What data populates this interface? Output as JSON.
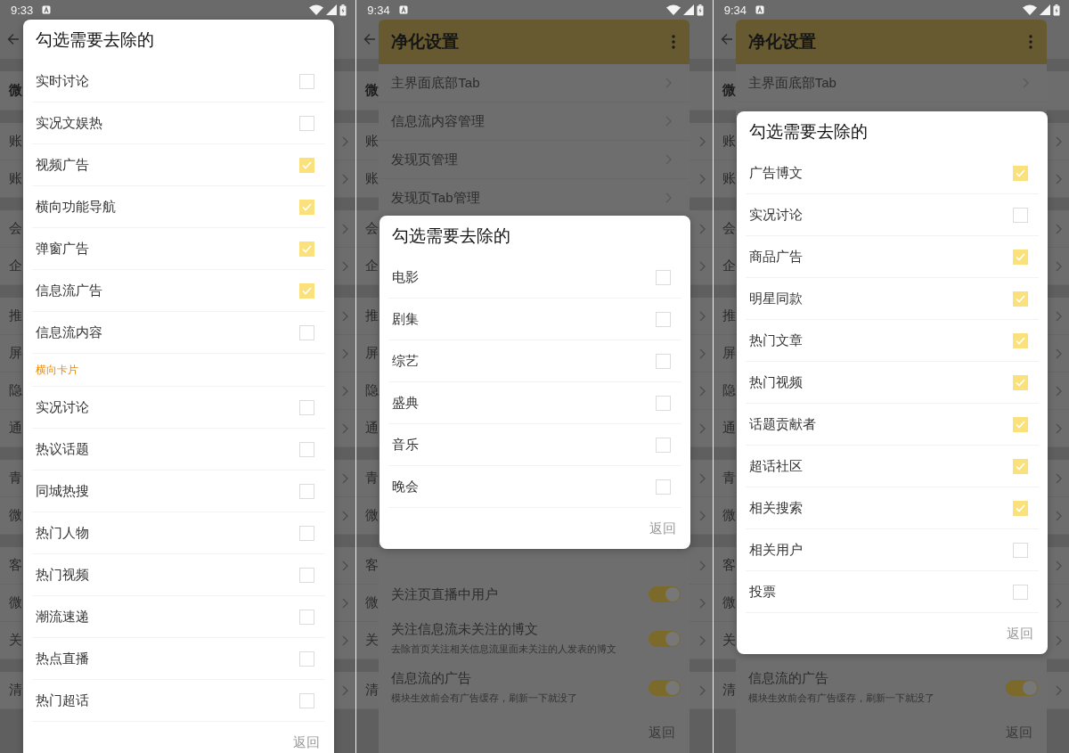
{
  "phones": [
    {
      "status_bar": {
        "time": "9:33"
      },
      "background_page": {
        "sections": [
          {
            "rows": [
              {
                "kind": "header",
                "label": "微"
              }
            ]
          },
          {
            "rows": [
              {
                "kind": "link",
                "label": "账"
              },
              {
                "kind": "link",
                "label": "账"
              }
            ]
          },
          {
            "rows": [
              {
                "kind": "link",
                "label": "会"
              },
              {
                "kind": "link",
                "label": "企"
              }
            ]
          },
          {
            "rows": [
              {
                "kind": "link",
                "label": "推"
              },
              {
                "kind": "link",
                "label": "屏"
              },
              {
                "kind": "link",
                "label": "隐"
              },
              {
                "kind": "link",
                "label": "通"
              }
            ]
          },
          {
            "rows": [
              {
                "kind": "link",
                "label": "青"
              },
              {
                "kind": "link",
                "label": "微"
              }
            ]
          },
          {
            "rows": [
              {
                "kind": "link",
                "label": "客"
              },
              {
                "kind": "link",
                "label": "微"
              },
              {
                "kind": "link",
                "label": "关"
              }
            ]
          },
          {
            "rows": [
              {
                "kind": "link",
                "label": "清"
              }
            ]
          }
        ]
      },
      "checklist_dialog": {
        "title": "勾选需要去除的",
        "items": [
          {
            "kind": "option",
            "label": "实时讨论",
            "checked": false
          },
          {
            "kind": "option",
            "label": "实况文娱热",
            "checked": false
          },
          {
            "kind": "option",
            "label": "视频广告",
            "checked": true
          },
          {
            "kind": "option",
            "label": "横向功能导航",
            "checked": true
          },
          {
            "kind": "option",
            "label": "弹窗广告",
            "checked": true
          },
          {
            "kind": "option",
            "label": "信息流广告",
            "checked": true
          },
          {
            "kind": "option",
            "label": "信息流内容",
            "checked": false
          },
          {
            "kind": "section",
            "label": "横向卡片"
          },
          {
            "kind": "option",
            "label": "实况讨论",
            "checked": false
          },
          {
            "kind": "option",
            "label": "热议话题",
            "checked": false
          },
          {
            "kind": "option",
            "label": "同城热搜",
            "checked": false
          },
          {
            "kind": "option",
            "label": "热门人物",
            "checked": false
          },
          {
            "kind": "option",
            "label": "热门视频",
            "checked": false
          },
          {
            "kind": "option",
            "label": "潮流速递",
            "checked": false
          },
          {
            "kind": "option",
            "label": "热点直播",
            "checked": false
          },
          {
            "kind": "option",
            "label": "热门超话",
            "checked": false
          }
        ],
        "footer_button": "返回"
      }
    },
    {
      "status_bar": {
        "time": "9:34"
      },
      "background_page": {
        "sections": [
          {
            "rows": [
              {
                "kind": "header",
                "label": "微"
              }
            ]
          },
          {
            "rows": [
              {
                "kind": "link",
                "label": "账"
              },
              {
                "kind": "link",
                "label": "账"
              }
            ]
          },
          {
            "rows": [
              {
                "kind": "link",
                "label": "会"
              },
              {
                "kind": "link",
                "label": "企"
              }
            ]
          },
          {
            "rows": [
              {
                "kind": "link",
                "label": "推"
              },
              {
                "kind": "link",
                "label": "屏"
              },
              {
                "kind": "link",
                "label": "隐"
              },
              {
                "kind": "link",
                "label": "通"
              }
            ]
          },
          {
            "rows": [
              {
                "kind": "link",
                "label": "青"
              },
              {
                "kind": "link",
                "label": "微"
              }
            ]
          },
          {
            "rows": [
              {
                "kind": "link",
                "label": "客"
              },
              {
                "kind": "link",
                "label": "微"
              },
              {
                "kind": "link",
                "label": "关"
              }
            ]
          },
          {
            "rows": [
              {
                "kind": "link",
                "label": "清"
              }
            ]
          }
        ]
      },
      "settings_dialog": {
        "title": "净化设置",
        "upper_items": [
          {
            "kind": "link",
            "label": "主界面底部Tab"
          },
          {
            "kind": "link",
            "label": "信息流内容管理"
          },
          {
            "kind": "link",
            "label": "发现页管理"
          },
          {
            "kind": "link",
            "label": "发现页Tab管理"
          }
        ],
        "lower_items": [
          {
            "kind": "toggle",
            "label": "关注页直播中用户",
            "on": true
          },
          {
            "kind": "toggle",
            "label": "关注信息流未关注的博文",
            "description": "去除首页关注相关信息流里面未关注的人发表的博文",
            "on": true
          },
          {
            "kind": "toggle",
            "label": "信息流的广告",
            "description": "模块生效前会有广告缓存，刷新一下就没了",
            "on": true
          }
        ],
        "footer_button": "返回"
      },
      "checklist_dialog": {
        "title": "勾选需要去除的",
        "items": [
          {
            "kind": "option",
            "label": "电影",
            "checked": false
          },
          {
            "kind": "option",
            "label": "剧集",
            "checked": false
          },
          {
            "kind": "option",
            "label": "综艺",
            "checked": false
          },
          {
            "kind": "option",
            "label": "盛典",
            "checked": false
          },
          {
            "kind": "option",
            "label": "音乐",
            "checked": false
          },
          {
            "kind": "option",
            "label": "晚会",
            "checked": false
          }
        ],
        "footer_button": "返回"
      }
    },
    {
      "status_bar": {
        "time": "9:34"
      },
      "background_page": {
        "sections": [
          {
            "rows": [
              {
                "kind": "header",
                "label": "微"
              }
            ]
          },
          {
            "rows": [
              {
                "kind": "link",
                "label": "账"
              },
              {
                "kind": "link",
                "label": "账"
              }
            ]
          },
          {
            "rows": [
              {
                "kind": "link",
                "label": "会"
              },
              {
                "kind": "link",
                "label": "企"
              }
            ]
          },
          {
            "rows": [
              {
                "kind": "link",
                "label": "推"
              },
              {
                "kind": "link",
                "label": "屏"
              },
              {
                "kind": "link",
                "label": "隐"
              },
              {
                "kind": "link",
                "label": "通"
              }
            ]
          },
          {
            "rows": [
              {
                "kind": "link",
                "label": "青"
              },
              {
                "kind": "link",
                "label": "微"
              }
            ]
          },
          {
            "rows": [
              {
                "kind": "link",
                "label": "客"
              },
              {
                "kind": "link",
                "label": "微"
              },
              {
                "kind": "link",
                "label": "关"
              }
            ]
          },
          {
            "rows": [
              {
                "kind": "link",
                "label": "清"
              }
            ]
          }
        ]
      },
      "settings_dialog": {
        "title": "净化设置",
        "upper_items": [
          {
            "kind": "link",
            "label": "主界面底部Tab"
          }
        ],
        "lower_items": [
          {
            "kind": "toggle",
            "label": "信息流的广告",
            "description": "模块生效前会有广告缓存，刷新一下就没了",
            "on": true
          }
        ],
        "footer_button": "返回"
      },
      "checklist_dialog": {
        "title": "勾选需要去除的",
        "items": [
          {
            "kind": "option",
            "label": "广告博文",
            "checked": true
          },
          {
            "kind": "option",
            "label": "实况讨论",
            "checked": false
          },
          {
            "kind": "option",
            "label": "商品广告",
            "checked": true
          },
          {
            "kind": "option",
            "label": "明星同款",
            "checked": true
          },
          {
            "kind": "option",
            "label": "热门文章",
            "checked": true
          },
          {
            "kind": "option",
            "label": "热门视频",
            "checked": true
          },
          {
            "kind": "option",
            "label": "话题贡献者",
            "checked": true
          },
          {
            "kind": "option",
            "label": "超话社区",
            "checked": true
          },
          {
            "kind": "option",
            "label": "相关搜索",
            "checked": true
          },
          {
            "kind": "option",
            "label": "相关用户",
            "checked": false
          },
          {
            "kind": "option",
            "label": "投票",
            "checked": false
          }
        ],
        "footer_button": "返回"
      }
    }
  ]
}
